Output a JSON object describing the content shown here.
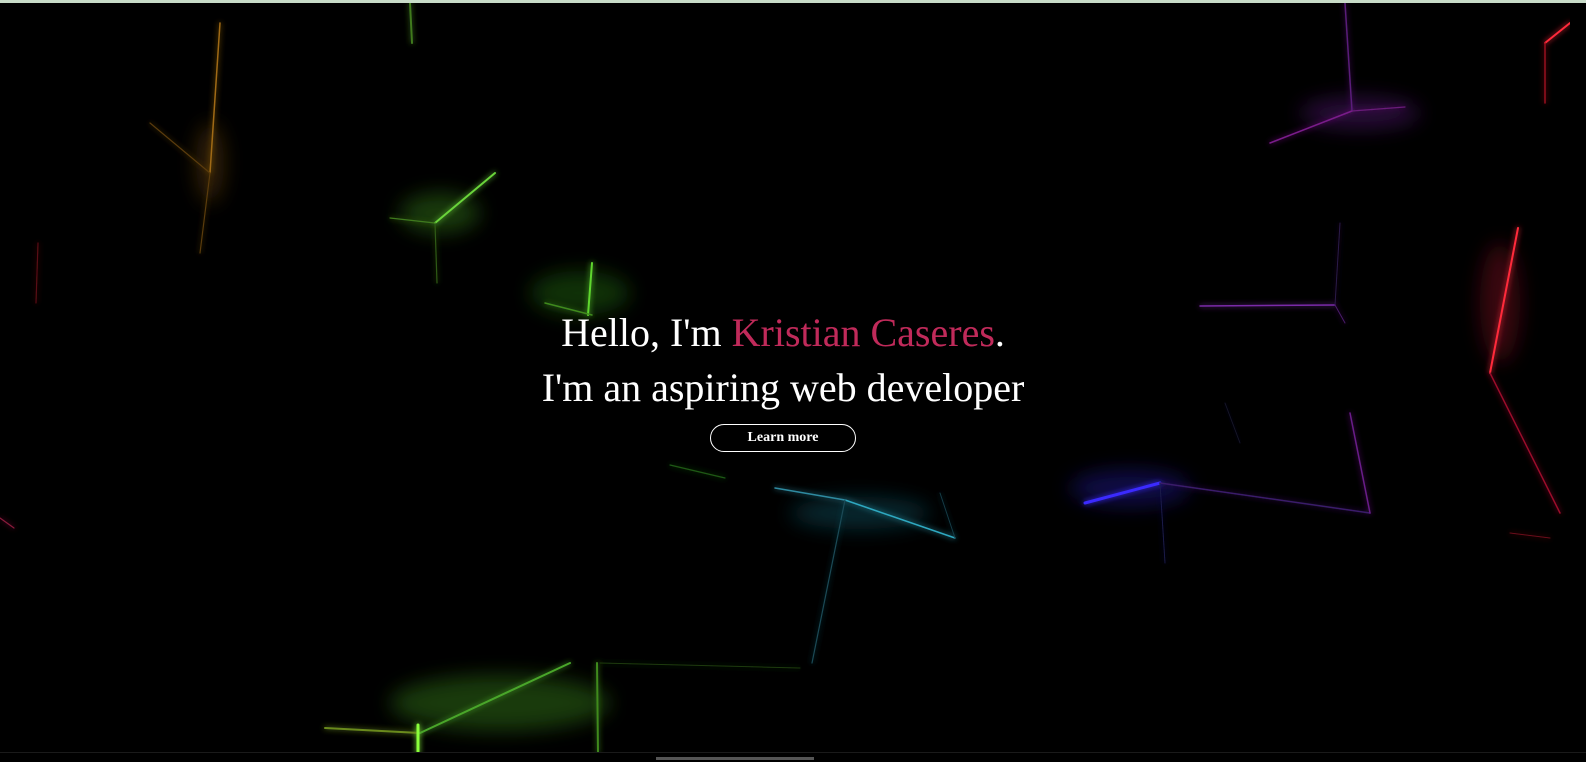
{
  "hero": {
    "greeting": "Hello, I'm ",
    "name": "Kristian Caseres",
    "period": ".",
    "subtitle": "I'm an aspiring web developer",
    "button_label": "Learn more"
  },
  "colors": {
    "background": "#000000",
    "text": "#ffffff",
    "accent": "#c02a5a",
    "glow_green": "#5ed62f",
    "glow_blue": "#3a2cff",
    "glow_red": "#ff2a3a",
    "glow_purple": "#8a2cc8",
    "glow_teal": "#2fa8c0",
    "glow_orange": "#c8841e"
  },
  "background": {
    "style": "dark low-poly shards with neon edge glows"
  }
}
